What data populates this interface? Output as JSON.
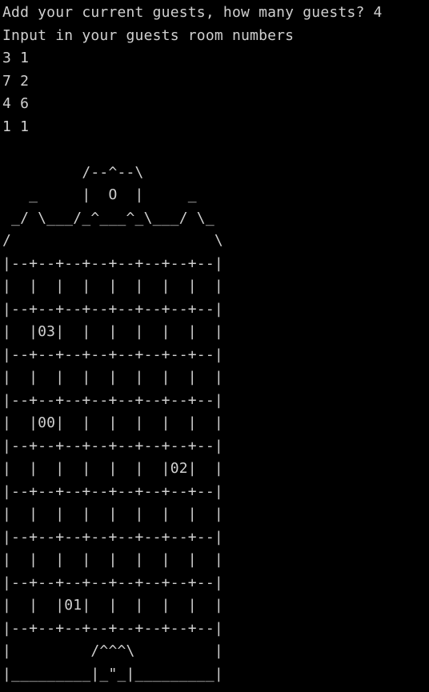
{
  "terminal": {
    "foreground": "#d0d0d0",
    "background": "#000000",
    "lines": [
      "Add your current guests, how many guests? 4",
      "Input in your guests room numbers",
      "3 1",
      "7 2",
      "4 6",
      "1 1",
      "",
      "         /--^--\\",
      "   _     |  O  |     _",
      " _/ \\___/_^___^_\\___/ \\_",
      "/                       \\",
      "|--+--+--+--+--+--+--+--|",
      "|  |  |  |  |  |  |  |  |",
      "|--+--+--+--+--+--+--+--|",
      "|  |03|  |  |  |  |  |  |",
      "|--+--+--+--+--+--+--+--|",
      "|  |  |  |  |  |  |  |  |",
      "|--+--+--+--+--+--+--+--|",
      "|  |00|  |  |  |  |  |  |",
      "|--+--+--+--+--+--+--+--|",
      "|  |  |  |  |  |  |02|  |",
      "|--+--+--+--+--+--+--+--|",
      "|  |  |  |  |  |  |  |  |",
      "|--+--+--+--+--+--+--+--|",
      "|  |  |  |  |  |  |  |  |",
      "|--+--+--+--+--+--+--+--|",
      "|  |  |01|  |  |  |  |  |",
      "|--+--+--+--+--+--+--+--|",
      "|         /^^^\\         |",
      "|_________|_\"_|_________|"
    ]
  }
}
